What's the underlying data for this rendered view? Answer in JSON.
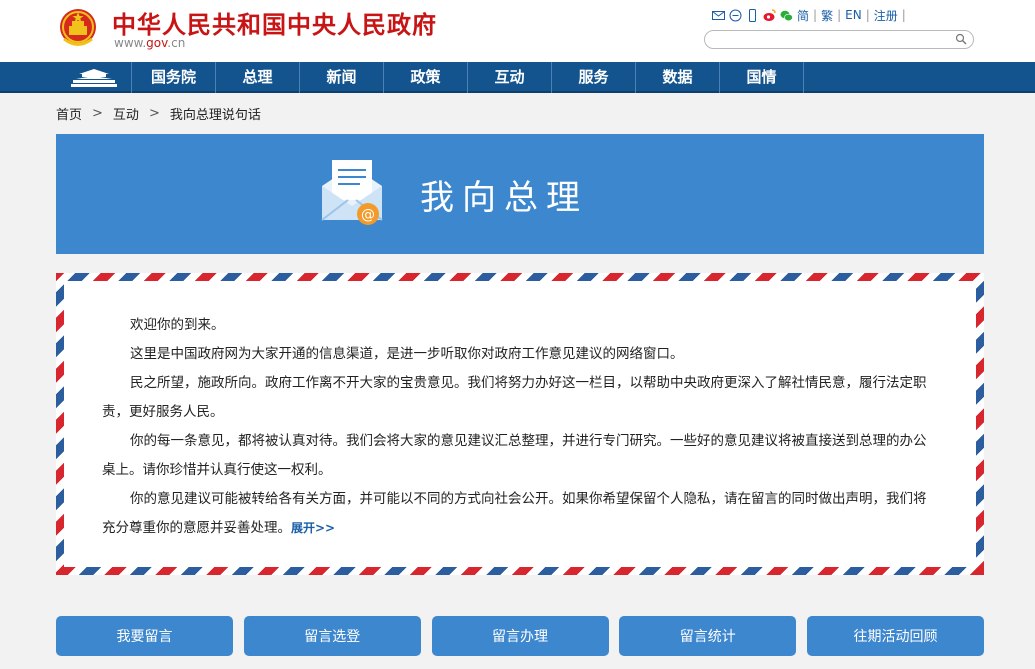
{
  "header": {
    "title": "中华人民共和国中央人民政府",
    "domain_prefix": "www.",
    "domain_mid": "gov",
    "domain_suffix": ".cn",
    "tools": {
      "simplified": "简",
      "traditional": "繁",
      "english": "EN",
      "register": "注册"
    },
    "search": {
      "value": "",
      "placeholder": ""
    },
    "accent_red": "#c81414"
  },
  "nav": {
    "items": [
      "国务院",
      "总理",
      "新闻",
      "政策",
      "互动",
      "服务",
      "数据",
      "国情"
    ],
    "color": "#14548e"
  },
  "breadcrumb": {
    "home": "首页",
    "sep": ">",
    "section": "互动",
    "current": "我向总理说句话"
  },
  "banner": {
    "title": "我向总理",
    "color": "#3d87cf"
  },
  "letter": {
    "p1": "欢迎你的到来。",
    "p2": "这里是中国政府网为大家开通的信息渠道，是进一步听取你对政府工作意见建议的网络窗口。",
    "p3": "民之所望，施政所向。政府工作离不开大家的宝贵意见。我们将努力办好这一栏目，以帮助中央政府更深入了解社情民意，履行法定职责，更好服务人民。",
    "p4": "你的每一条意见，都将被认真对待。我们会将大家的意见建议汇总整理，并进行专门研究。一些好的意见建议将被直接送到总理的办公桌上。请你珍惜并认真行使这一权利。",
    "p5": "你的意见建议可能被转给各有关方面，并可能以不同的方式向社会公开。如果你希望保留个人隐私，请在留言的同时做出声明，我们将充分尊重你的意愿并妥善处理。",
    "more": "展开>>"
  },
  "actions": {
    "leave_message": "我要留言",
    "selected": "留言选登",
    "handling": "留言办理",
    "stats": "留言统计",
    "review": "往期活动回顾"
  }
}
